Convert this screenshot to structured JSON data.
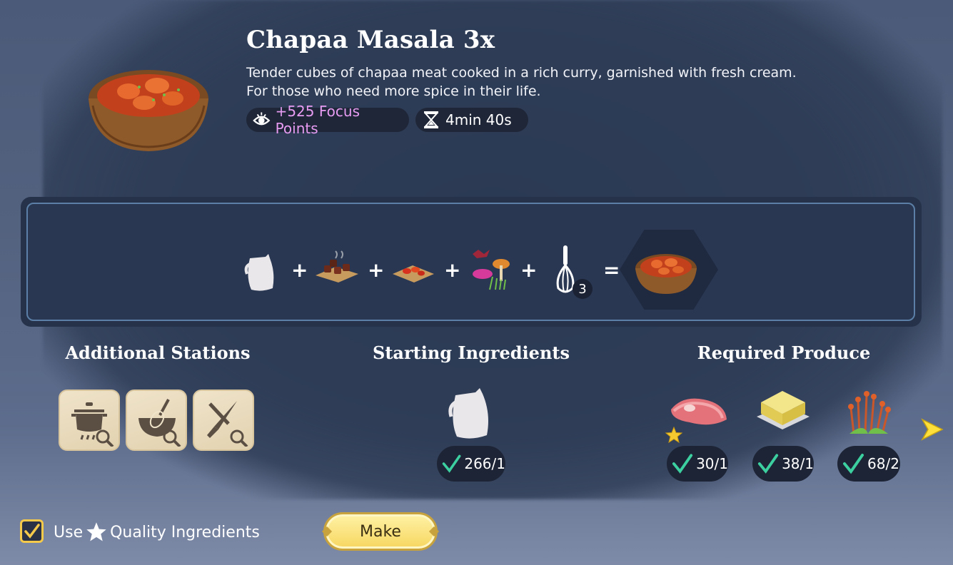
{
  "recipe": {
    "title": "Chapaa Masala 3x",
    "description_line1": "Tender cubes of chapaa meat cooked in a rich curry, garnished with fresh cream.",
    "description_line2": "For those who need more spice in their life.",
    "focus_points": "+525 Focus Points",
    "cook_time": "4min 40s"
  },
  "equation": {
    "operators": [
      "+",
      "+",
      "+",
      "+",
      "="
    ],
    "whisk_count": "3",
    "items": [
      "milk-jug-icon",
      "chopped-meat-board-icon",
      "sliced-peppers-board-icon",
      "spice-mushroom-icon",
      "whisk-icon"
    ],
    "result": "chapaa-masala-bowl-icon"
  },
  "sections": {
    "stations": "Additional Stations",
    "starting": "Starting Ingredients",
    "produce": "Required Produce"
  },
  "stations": [
    {
      "icon": "cooking-pot-icon"
    },
    {
      "icon": "mixing-bowl-whisk-icon"
    },
    {
      "icon": "knife-cutting-icon"
    }
  ],
  "starting_ingredients": [
    {
      "icon": "milk-jug-icon",
      "count": "266/1"
    }
  ],
  "required_produce": [
    {
      "icon": "raw-meat-icon",
      "count": "30/1",
      "quality_star": true
    },
    {
      "icon": "butter-icon",
      "count": "38/1"
    },
    {
      "icon": "spice-sprouts-icon",
      "count": "68/2"
    }
  ],
  "controls": {
    "use_label": "Use",
    "quality_label": "Quality Ingredients",
    "quality_checked": true,
    "make_label": "Make"
  },
  "colors": {
    "focus_text": "#e79cf2",
    "check_green": "#3ccfa0",
    "accent_yellow": "#f5c94a"
  }
}
